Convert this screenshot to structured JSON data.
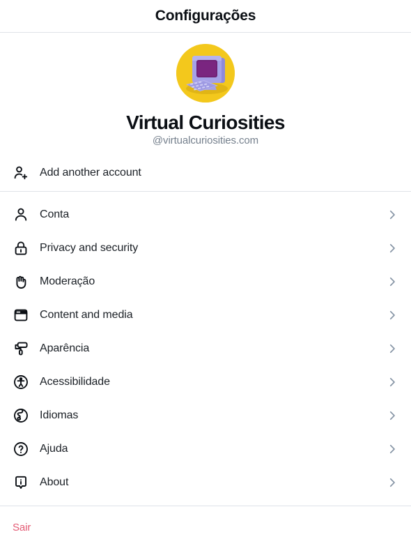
{
  "header": {
    "title": "Configurações"
  },
  "profile": {
    "avatar_icon": "retro-computer-avatar",
    "avatar_bg_color": "#f3c81c",
    "avatar_screen_color": "#6c1f72",
    "avatar_case_color": "#9a96e0",
    "display_name": "Virtual Curiosities",
    "handle": "@virtualcuriosities.com"
  },
  "add_account": {
    "icon": "person-add-icon",
    "label": "Add another account"
  },
  "menu": {
    "chevron_icon": "chevron-right-icon",
    "chevron_color": "#8795a6",
    "items": [
      {
        "id": "conta",
        "icon": "person-icon",
        "label": "Conta"
      },
      {
        "id": "privacy-security",
        "icon": "lock-icon",
        "label": "Privacy and security"
      },
      {
        "id": "moderacao",
        "icon": "raised-hand-icon",
        "label": "Moderação"
      },
      {
        "id": "content-media",
        "icon": "window-icon",
        "label": "Content and media"
      },
      {
        "id": "aparencia",
        "icon": "paint-roller-icon",
        "label": "Aparência"
      },
      {
        "id": "acessibilidade",
        "icon": "accessibility-icon",
        "label": "Acessibilidade"
      },
      {
        "id": "idiomas",
        "icon": "globe-icon",
        "label": "Idiomas"
      },
      {
        "id": "ajuda",
        "icon": "question-circle-icon",
        "label": "Ajuda"
      },
      {
        "id": "about",
        "icon": "info-bubble-icon",
        "label": "About"
      }
    ]
  },
  "footer": {
    "logout_label": "Sair",
    "logout_color": "#e45a74"
  }
}
